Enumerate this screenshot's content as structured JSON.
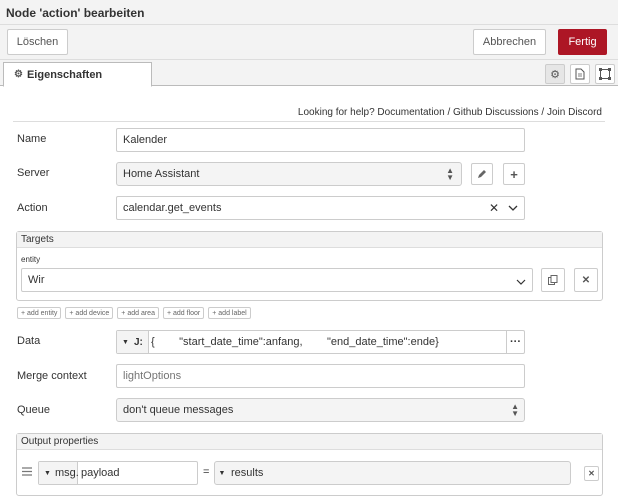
{
  "header": {
    "title": "Node 'action' bearbeiten"
  },
  "toolbar": {
    "delete_label": "Löschen",
    "cancel_label": "Abbrechen",
    "done_label": "Fertig"
  },
  "tabs": {
    "properties_label": "Eigenschaften"
  },
  "help": {
    "prefix": "Looking for help?",
    "documentation": "Documentation",
    "sep": "/",
    "github": "Github Discussions",
    "discord": "Join Discord"
  },
  "form": {
    "name_label": "Name",
    "name_value": "Kalender",
    "server_label": "Server",
    "server_value": "Home Assistant",
    "action_label": "Action",
    "action_value": "calendar.get_events",
    "targets_label": "Targets",
    "entity_label": "entity",
    "entity_value": "Wir",
    "add_chips": [
      "+ add entity",
      "+ add device",
      "+ add area",
      "+ add floor",
      "+ add label"
    ],
    "data_label": "Data",
    "data_value": "{        \"start_date_time\":anfang,        \"end_date_time\":ende}",
    "data_type_glyph": "J:",
    "merge_label": "Merge context",
    "merge_placeholder": "lightOptions",
    "queue_label": "Queue",
    "queue_value": "don't queue messages",
    "output_label": "Output properties",
    "output_prefix": "msg.",
    "output_property": "payload",
    "output_equals": "=",
    "output_value": "results"
  },
  "icons": {
    "gear": "gear-icon",
    "doc": "document-icon",
    "frame": "layout-icon",
    "edit": "pencil-icon",
    "add": "plus-icon",
    "clear": "times-icon",
    "chevron": "chevron-down-icon",
    "copy": "copy-icon",
    "remove": "close-icon",
    "more": "ellipsis-icon",
    "drag": "drag-handle-icon"
  },
  "colors": {
    "primary": "#ad1625"
  }
}
